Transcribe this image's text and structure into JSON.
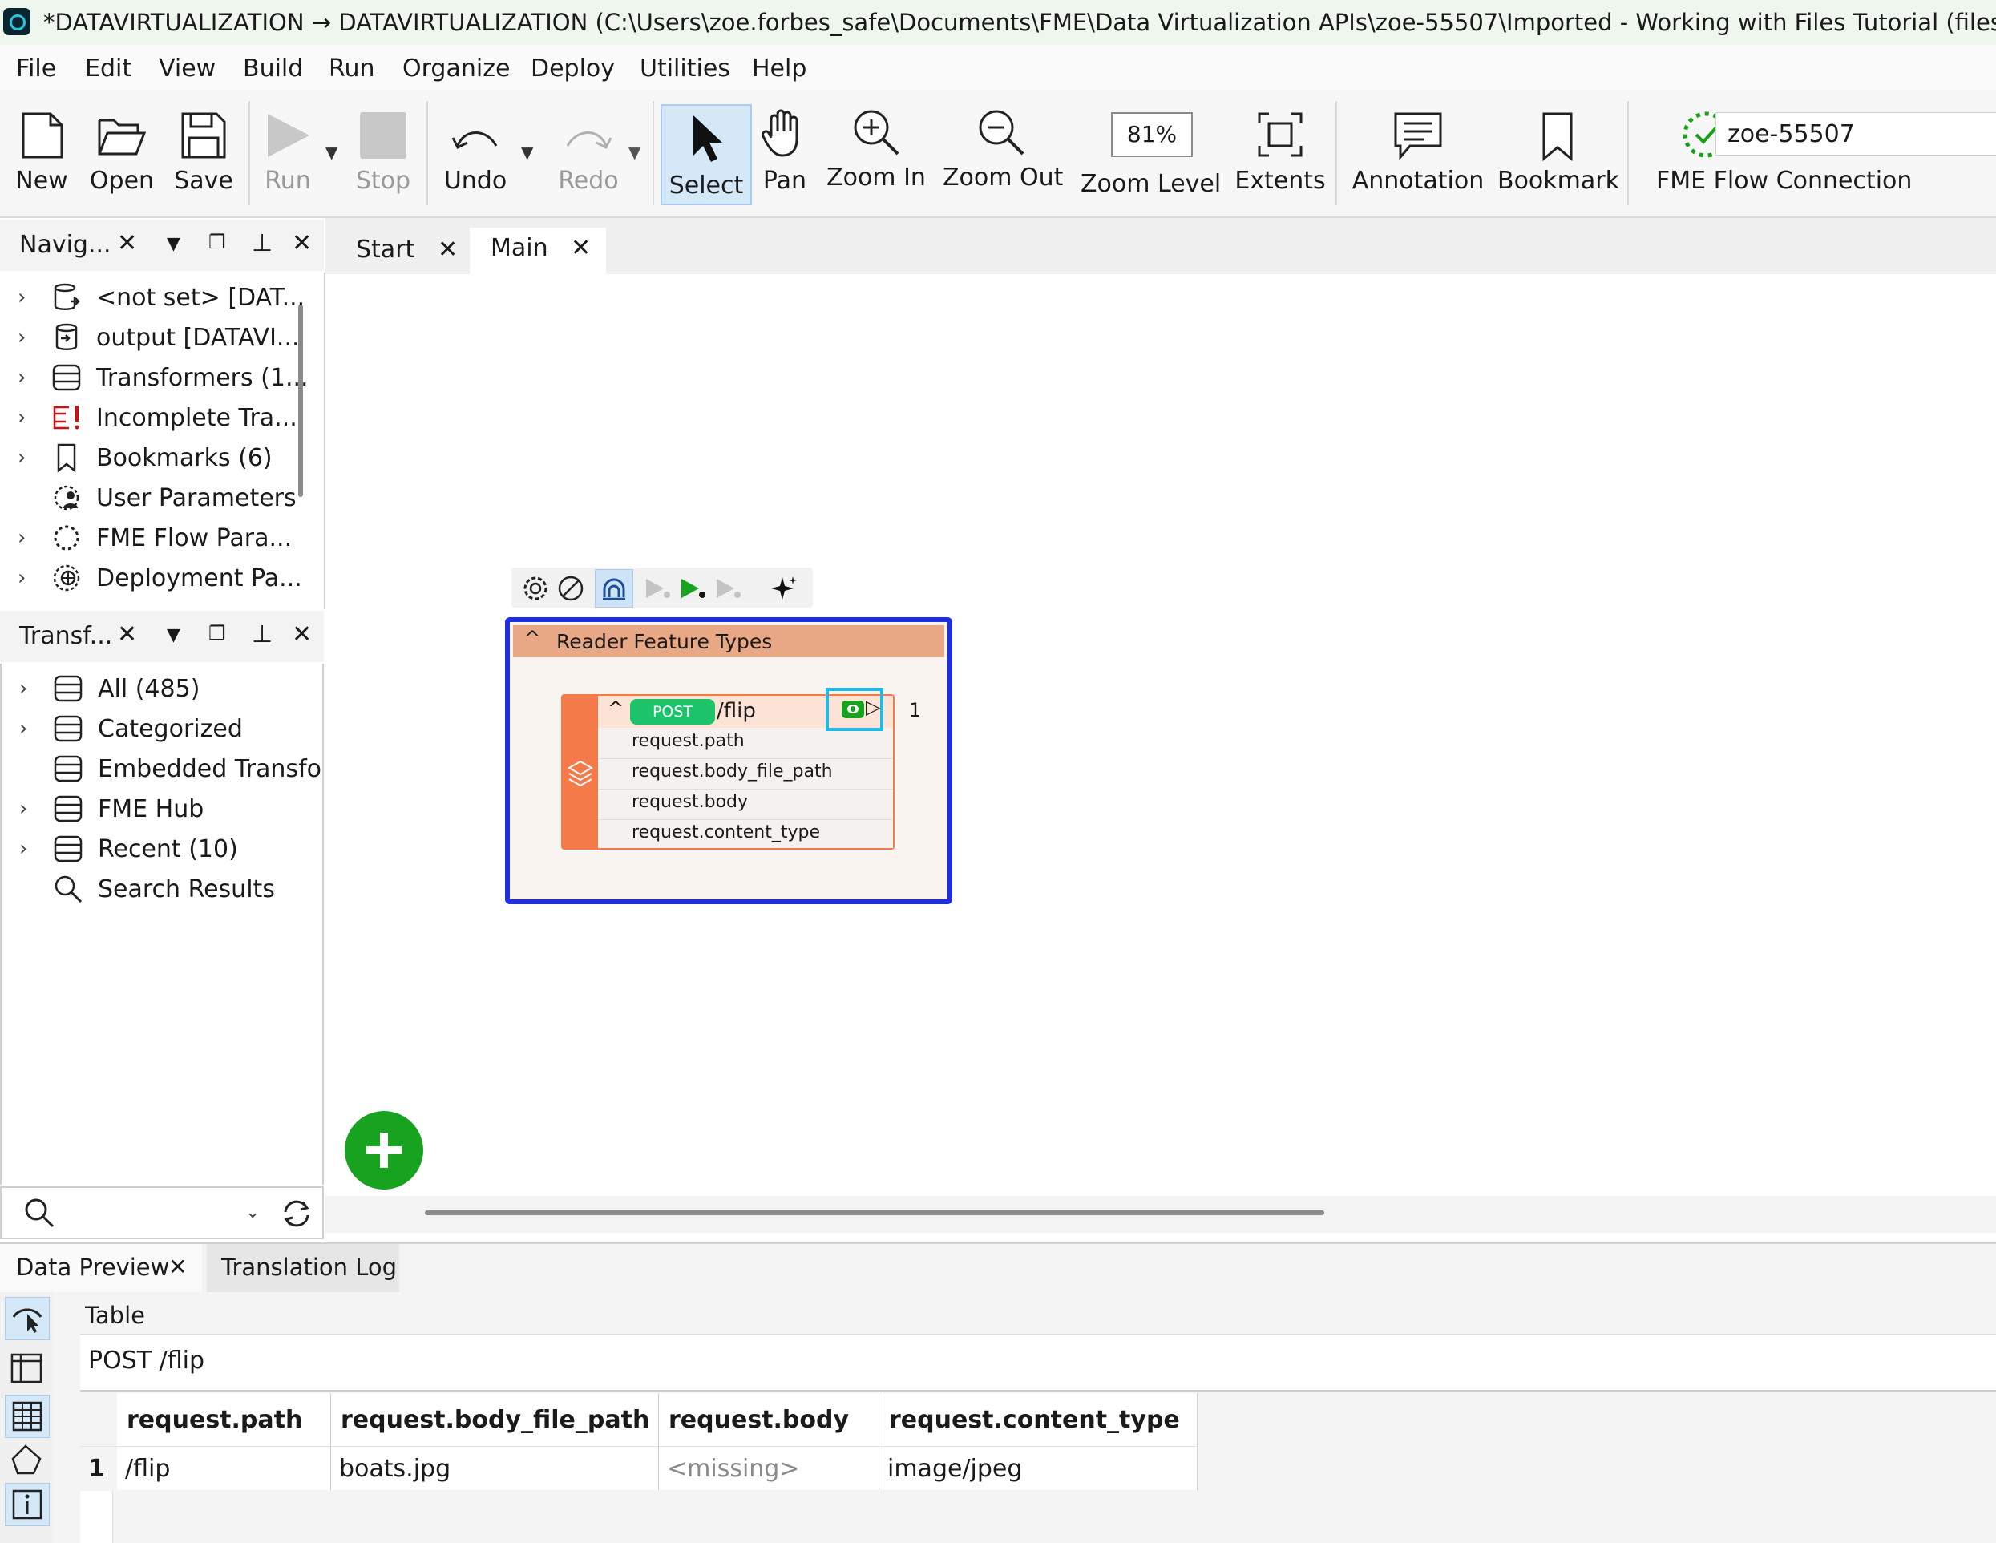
{
  "window": {
    "title": "*DATAVIRTUALIZATION → DATAVIRTUALIZATION (C:\\Users\\zoe.forbes_safe\\Documents\\FME\\Data Virtualization APIs\\zoe-55507\\Imported - Working with Files Tutorial (files)\\flip_endpoi"
  },
  "menu": [
    "File",
    "Edit",
    "View",
    "Build",
    "Run",
    "Organize",
    "Deploy",
    "Utilities",
    "Help"
  ],
  "toolbar": {
    "new": "New",
    "open": "Open",
    "save": "Save",
    "run": "Run",
    "stop": "Stop",
    "undo": "Undo",
    "redo": "Redo",
    "select": "Select",
    "pan": "Pan",
    "zoom_in": "Zoom In",
    "zoom_out": "Zoom Out",
    "zoom_level_value": "81%",
    "zoom_level": "Zoom Level",
    "extents": "Extents",
    "annotation": "Annotation",
    "bookmark": "Bookmark",
    "connection_value": "zoe-55507",
    "connection": "FME Flow Connection"
  },
  "navigator": {
    "title": "Navig...",
    "items": [
      {
        "label": "<not set> [DAT...",
        "icon": "database-read-icon",
        "expand": true
      },
      {
        "label": "output [DATAVI...",
        "icon": "database-write-icon",
        "expand": true
      },
      {
        "label": "Transformers (1...",
        "icon": "transformers-icon",
        "expand": true
      },
      {
        "label": "Incomplete Tra...",
        "icon": "incomplete-icon",
        "expand": true
      },
      {
        "label": "Bookmarks (6)",
        "icon": "bookmark-icon",
        "expand": true
      },
      {
        "label": "User Parameters",
        "icon": "user-parameters-icon",
        "expand": false
      },
      {
        "label": "FME Flow Para...",
        "icon": "flow-parameters-icon",
        "expand": true
      },
      {
        "label": "Deployment Pa...",
        "icon": "deployment-icon",
        "expand": true
      }
    ]
  },
  "transformer_gallery": {
    "title": "Transf...",
    "items": [
      {
        "label": "All (485)",
        "expand": true
      },
      {
        "label": "Categorized",
        "expand": true
      },
      {
        "label": "Embedded Transfo...",
        "expand": false
      },
      {
        "label": "FME Hub",
        "expand": true
      },
      {
        "label": "Recent (10)",
        "expand": true
      },
      {
        "label": "Search Results",
        "expand": false,
        "icon": "search-icon"
      }
    ]
  },
  "tabs": [
    {
      "label": "Start",
      "selected": false
    },
    {
      "label": "Main",
      "selected": true
    }
  ],
  "canvas": {
    "bookmark_title": "Reader Feature Types",
    "feature_type": {
      "method": "POST",
      "name": "/flip",
      "count": "1",
      "attributes": [
        "request.path",
        "request.body_file_path",
        "request.body",
        "request.content_type"
      ]
    }
  },
  "bottom": {
    "tabs": [
      "Data Preview",
      "Translation Log"
    ],
    "section": "Table",
    "feature_type": "POST /flip",
    "columns": [
      "request.path",
      "request.body_file_path",
      "request.body",
      "request.content_type"
    ],
    "rows": [
      {
        "index": "1",
        "cells": [
          "/flip",
          "boats.jpg",
          "<missing>",
          "image/jpeg"
        ]
      }
    ]
  },
  "colors": {
    "accent_blue": "#1f2fe0",
    "header_orange": "#e9a885",
    "feature_orange": "#f47a4a",
    "post_green": "#1cc36a",
    "highlight_cyan": "#1fb9e8",
    "add_green": "#17a21f"
  }
}
